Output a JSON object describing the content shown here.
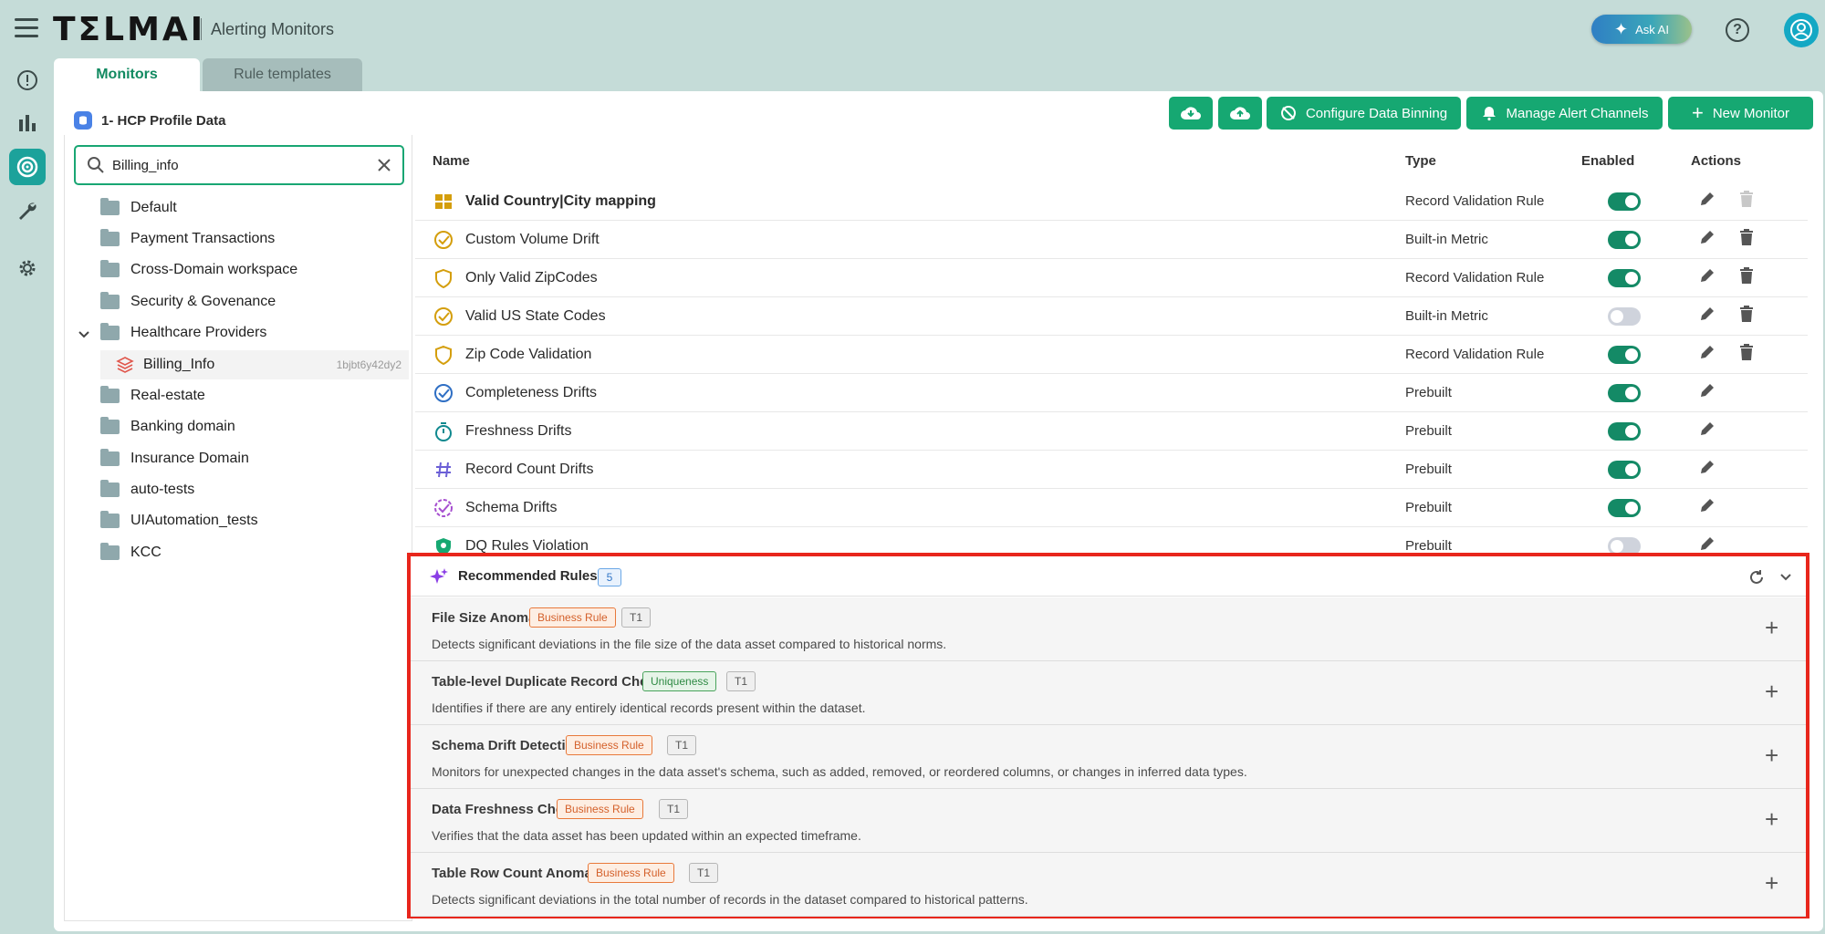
{
  "header": {
    "logo": "TΣLMAI",
    "app_title": "Alerting Monitors",
    "ask_ai": "Ask AI"
  },
  "tabs": [
    {
      "label": "Monitors",
      "active": true
    },
    {
      "label": "Rule templates",
      "active": false
    }
  ],
  "dataset": {
    "name": "1- HCP Profile Data"
  },
  "toolbar": {
    "configure_label": "Configure Data Binning",
    "alerts_label": "Manage Alert Channels",
    "new_label": "New Monitor"
  },
  "search": {
    "value": "Billing_info"
  },
  "tree": {
    "folders": [
      "Default",
      "Payment Transactions",
      "Cross-Domain workspace",
      "Security & Govenance",
      "Healthcare Providers",
      "Real-estate",
      "Banking domain",
      "Insurance Domain",
      "auto-tests",
      "UIAutomation_tests",
      "KCC"
    ],
    "leaf": {
      "label": "Billing_Info",
      "id": "1bjbt6y42dy2"
    }
  },
  "table": {
    "headers": {
      "name": "Name",
      "type": "Type",
      "enabled": "Enabled",
      "actions": "Actions"
    },
    "rows": [
      {
        "name": "Valid Country|City mapping",
        "type": "Record Validation Rule",
        "enabled": true,
        "icon": "table-grid-icon",
        "bold": true,
        "deletable": false
      },
      {
        "name": "Custom Volume Drift",
        "type": "Built-in Metric",
        "enabled": true,
        "icon": "check-circle-icon",
        "bold": false,
        "deletable": true
      },
      {
        "name": "Only Valid ZipCodes",
        "type": "Record Validation Rule",
        "enabled": true,
        "icon": "shield-icon",
        "bold": false,
        "deletable": true
      },
      {
        "name": "Valid US State Codes",
        "type": "Built-in Metric",
        "enabled": false,
        "icon": "check-circle-icon",
        "bold": false,
        "deletable": true
      },
      {
        "name": "Zip Code Validation",
        "type": "Record Validation Rule",
        "enabled": true,
        "icon": "shield-icon",
        "bold": false,
        "deletable": true
      },
      {
        "name": "Completeness Drifts",
        "type": "Prebuilt",
        "enabled": true,
        "icon": "check-circle-blue-icon",
        "bold": false,
        "deletable": false
      },
      {
        "name": "Freshness Drifts",
        "type": "Prebuilt",
        "enabled": true,
        "icon": "stopwatch-icon",
        "bold": false,
        "deletable": false
      },
      {
        "name": "Record Count Drifts",
        "type": "Prebuilt",
        "enabled": true,
        "icon": "hash-icon",
        "bold": false,
        "deletable": false
      },
      {
        "name": "Schema Drifts",
        "type": "Prebuilt",
        "enabled": true,
        "icon": "badge-check-icon",
        "bold": false,
        "deletable": false
      },
      {
        "name": "DQ Rules Violation",
        "type": "Prebuilt",
        "enabled": false,
        "icon": "shield-green-icon",
        "bold": false,
        "deletable": false
      }
    ]
  },
  "recommended": {
    "title": "Recommended Rules",
    "count": "5",
    "items": [
      {
        "name": "File Size Anomaly",
        "category": "Business Rule",
        "category_kind": "biz",
        "tier": "T1",
        "description": "Detects significant deviations in the file size of the data asset compared to historical norms."
      },
      {
        "name": "Table-level Duplicate Record Check",
        "category": "Uniqueness",
        "category_kind": "uniq",
        "tier": "T1",
        "description": "Identifies if there are any entirely identical records present within the dataset."
      },
      {
        "name": "Schema Drift Detection",
        "category": "Business Rule",
        "category_kind": "biz",
        "tier": "T1",
        "description": "Monitors for unexpected changes in the data asset's schema, such as added, removed, or reordered columns, or changes in inferred data types."
      },
      {
        "name": "Data Freshness Check",
        "category": "Business Rule",
        "category_kind": "biz",
        "tier": "T1",
        "description": "Verifies that the data asset has been updated within an expected timeframe."
      },
      {
        "name": "Table Row Count Anomaly",
        "category": "Business Rule",
        "category_kind": "biz",
        "tier": "T1",
        "description": "Detects significant deviations in the total number of records in the dataset compared to historical patterns."
      }
    ]
  },
  "colors": {
    "accent": "#16a872",
    "highlight_border": "#e8261c",
    "rail_active": "#1ca29b"
  }
}
